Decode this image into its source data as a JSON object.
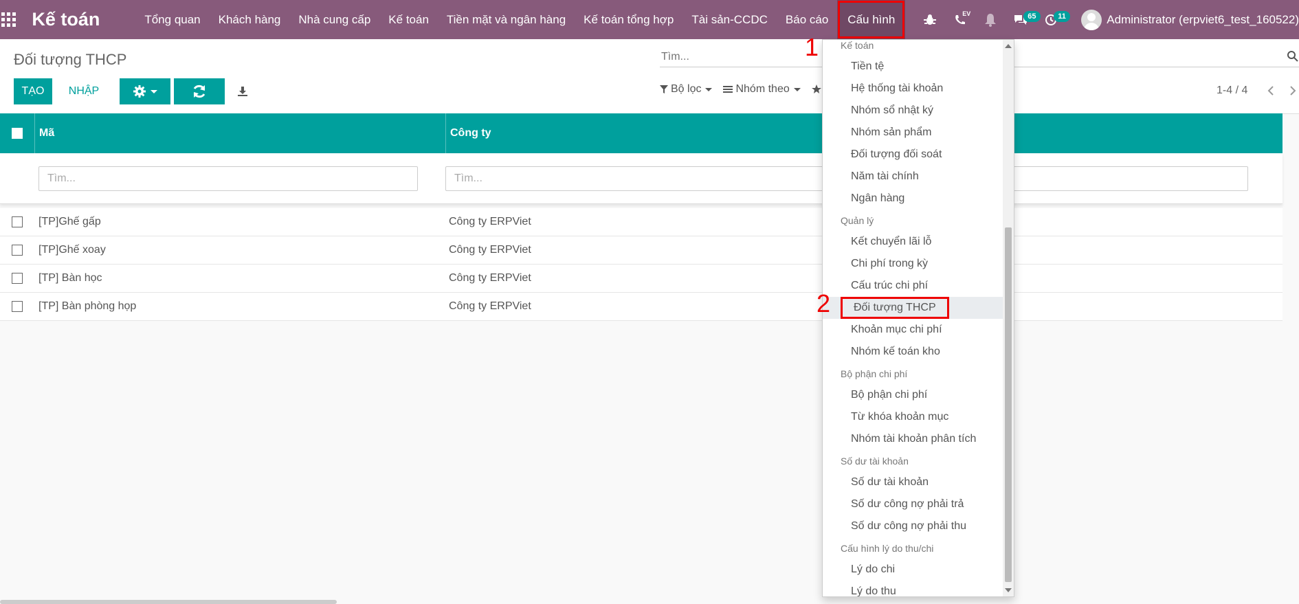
{
  "navbar": {
    "app_title": "Kế toán",
    "menu": [
      "Tổng quan",
      "Khách hàng",
      "Nhà cung cấp",
      "Kế toán",
      "Tiền mặt và ngân hàng",
      "Kế toán tổng hợp",
      "Tài sản-CCDC",
      "Báo cáo",
      "Cấu hình"
    ],
    "active_menu": "Cấu hình",
    "messages_count": "65",
    "activities_count": "11",
    "voip_label": "EV",
    "user_label": "Administrator (erpviet6_test_160522)"
  },
  "control": {
    "title": "Đối tượng THCP",
    "create_label": "TẠO",
    "import_label": "NHẬP",
    "search_placeholder": "Tìm...",
    "filter_label": "Bộ lọc",
    "groupby_label": "Nhóm theo",
    "pager": "1-4 / 4"
  },
  "table": {
    "headers": {
      "code": "Mã",
      "company": "Công ty"
    },
    "filter_placeholder": "Tìm...",
    "rows": [
      {
        "code": "[TP]Ghế gấp",
        "company": "Công ty ERPViet"
      },
      {
        "code": "[TP]Ghế xoay",
        "company": "Công ty ERPViet"
      },
      {
        "code": "[TP] Bàn học",
        "company": "Công ty ERPViet"
      },
      {
        "code": "[TP] Bàn phòng họp",
        "company": "Công ty ERPViet"
      }
    ]
  },
  "dropdown": {
    "sections": [
      {
        "header": "Kế toán",
        "items": [
          "Tiền tệ",
          "Hệ thống tài khoản",
          "Nhóm sổ nhật ký",
          "Nhóm sản phẩm",
          "Đối tượng đối soát",
          "Năm tài chính",
          "Ngân hàng"
        ]
      },
      {
        "header": "Quản lý",
        "items": [
          "Kết chuyển lãi lỗ",
          "Chi phí trong kỳ",
          "Cấu trúc chi phí",
          "Đối tượng THCP",
          "Khoản mục chi phí",
          "Nhóm kế toán kho"
        ]
      },
      {
        "header": "Bộ phận chi phí",
        "items": [
          "Bộ phận chi phí",
          "Từ khóa khoản mục",
          "Nhóm tài khoản phân tích"
        ]
      },
      {
        "header": "Số dư tài khoản",
        "items": [
          "Số dư tài khoản",
          "Số dư công nợ phải trả",
          "Số dư công nợ phải thu"
        ]
      },
      {
        "header": "Cấu hình lý do thu/chi",
        "items": [
          "Lý do chi",
          "Lý do thu"
        ]
      }
    ],
    "active_item": "Đối tượng THCP"
  },
  "annotations": {
    "step1": "1",
    "step2": "2"
  },
  "colors": {
    "navbar": "#875a7b",
    "primary": "#00a09d",
    "highlight": "#e00000"
  }
}
